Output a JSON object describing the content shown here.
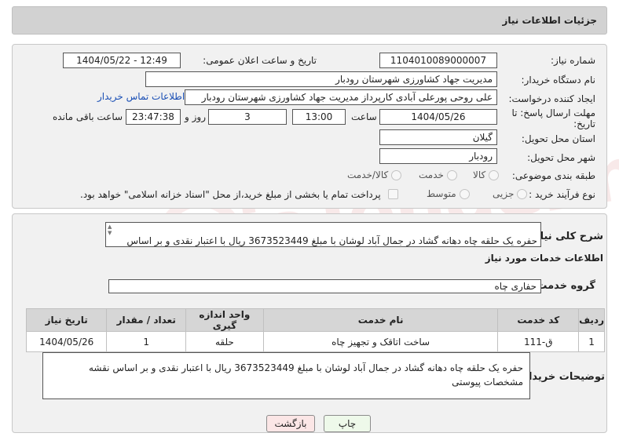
{
  "header": {
    "title": "جزئیات اطلاعات نیاز"
  },
  "fields": {
    "need_number_label": "شماره نیاز:",
    "need_number": "1104010089000007",
    "announce_label": "تاریخ و ساعت اعلان عمومی:",
    "announce_value": "1404/05/22 - 12:49",
    "buyer_org_label": "نام دستگاه خریدار:",
    "buyer_org": "مدیریت جهاد کشاورزی شهرستان رودبار",
    "requester_label": "ایجاد کننده درخواست:",
    "requester": "علی روحی پورعلی آبادی کارپرداز مدیریت جهاد کشاورزی شهرستان رودبار",
    "contact_link": "اطلاعات تماس خریدار",
    "deadline_label_1": "مهلت ارسال پاسخ: تا",
    "deadline_label_2": "تاریخ:",
    "deadline_date": "1404/05/26",
    "time_label": "ساعت",
    "deadline_time": "13:00",
    "days_value": "3",
    "days_label": "روز و",
    "remaining_time": "23:47:38",
    "remaining_label": "ساعت باقی مانده",
    "province_label": "استان محل تحویل:",
    "province": "گیلان",
    "city_label": "شهر محل تحویل:",
    "city": "رودبار",
    "category_label": "طبقه بندی موضوعی:",
    "category_options": [
      "کالا",
      "خدمت",
      "کالا/خدمت"
    ],
    "process_label": "نوع فرآیند خرید :",
    "process_options": [
      "جزیی",
      "متوسط"
    ],
    "payment_note": "پرداخت تمام یا بخشی از مبلغ خرید،از محل \"اسناد خزانه اسلامی\" خواهد بود."
  },
  "summary": {
    "label": "شرح کلی نیاز:",
    "text": "حفره یک حلقه چاه دهانه گشاد در جمال آباد لوشان با مبلغ 3673523449 ریال با اعتبار نقدی و بر اساس"
  },
  "services": {
    "section_title": "اطلاعات خدمات مورد نیاز",
    "group_label": "گروه خدمت:",
    "group_value": "حفاری چاه",
    "columns": [
      "ردیف",
      "کد خدمت",
      "نام خدمت",
      "واحد اندازه گیری",
      "تعداد / مقدار",
      "تاریخ نیاز"
    ],
    "rows": [
      [
        "1",
        "ق-111",
        "ساخت اتاقک و تجهیز چاه",
        "حلقه",
        "1",
        "1404/05/26"
      ]
    ]
  },
  "buyer_notes": {
    "label": "توضیحات خریدار:",
    "text": "حفره یک حلقه چاه دهانه گشاد در جمال آباد لوشان با مبلغ 3673523449 ریال با اعتبار نقدی و بر اساس نقشه مشخصات پیوستی"
  },
  "buttons": {
    "print": "چاپ",
    "back": "بازگشت"
  },
  "watermark": "AriaTender.neT",
  "colors": {
    "link": "#1a4fb5",
    "print_bg": "#eef9ea",
    "back_bg": "#fbe6e6",
    "panel": "#f1f1f1"
  }
}
